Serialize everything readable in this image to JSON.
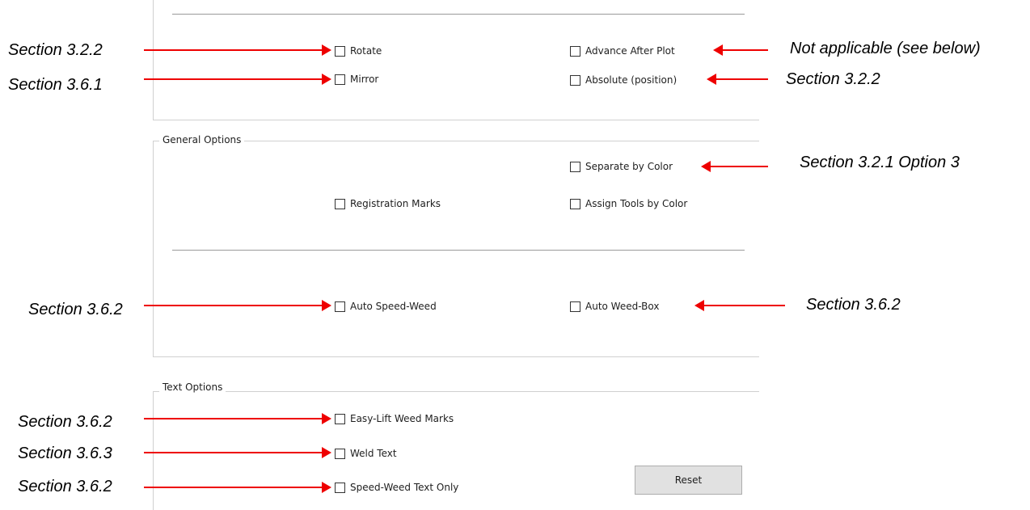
{
  "groups": {
    "general_title": "General Options",
    "text_title": "Text Options"
  },
  "checkboxes": {
    "rotate": "Rotate",
    "mirror": "Mirror",
    "advance_after_plot": "Advance After Plot",
    "absolute_position": "Absolute (position)",
    "separate_by_color": "Separate by Color",
    "registration_marks": "Registration Marks",
    "assign_tools_by_color": "Assign Tools by Color",
    "auto_speed_weed": "Auto Speed-Weed",
    "auto_weed_box": "Auto Weed-Box",
    "easy_lift_weed_marks": "Easy-Lift Weed Marks",
    "weld_text": "Weld Text",
    "speed_weed_text_only": "Speed-Weed Text Only"
  },
  "buttons": {
    "reset": "Reset"
  },
  "annotations": {
    "rotate": "Section 3.2.2",
    "mirror": "Section 3.6.1",
    "advance_after_plot": "Not applicable (see below)",
    "absolute_position": "Section 3.2.2",
    "separate_by_color": "Section 3.2.1 Option 3",
    "auto_speed_weed": "Section 3.6.2",
    "auto_weed_box": "Section 3.6.2",
    "easy_lift_weed_marks": "Section 3.6.2",
    "weld_text": "Section 3.6.3",
    "speed_weed_text_only": "Section 3.6.2"
  },
  "colors": {
    "arrow": "#ee0000",
    "button_face": "#e1e1e1",
    "frame_line": "#d0d0d0"
  }
}
